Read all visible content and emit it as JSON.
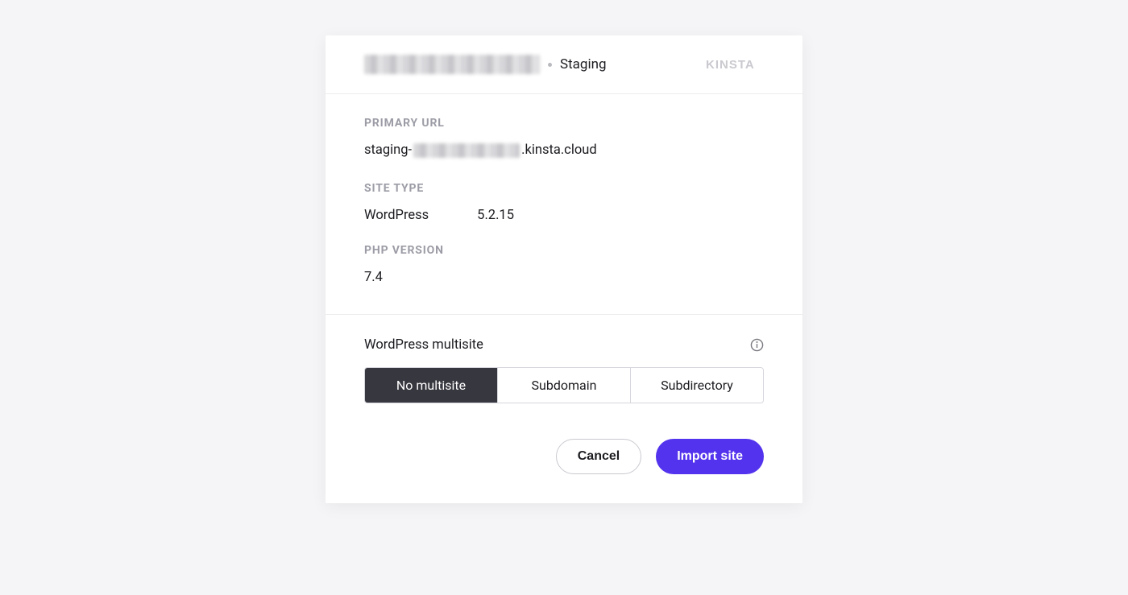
{
  "header": {
    "env_label": "Staging",
    "logo_text": "KINSTA"
  },
  "sections": {
    "primary_url": {
      "label": "PRIMARY URL",
      "prefix": "staging-",
      "suffix": ".kinsta.cloud"
    },
    "site_type": {
      "label": "SITE TYPE",
      "platform": "WordPress",
      "version": "5.2.15"
    },
    "php_version": {
      "label": "PHP VERSION",
      "value": "7.4"
    }
  },
  "multisite": {
    "title": "WordPress multisite",
    "options": [
      "No multisite",
      "Subdomain",
      "Subdirectory"
    ],
    "selected_index": 0
  },
  "footer": {
    "cancel": "Cancel",
    "import": "Import site"
  }
}
